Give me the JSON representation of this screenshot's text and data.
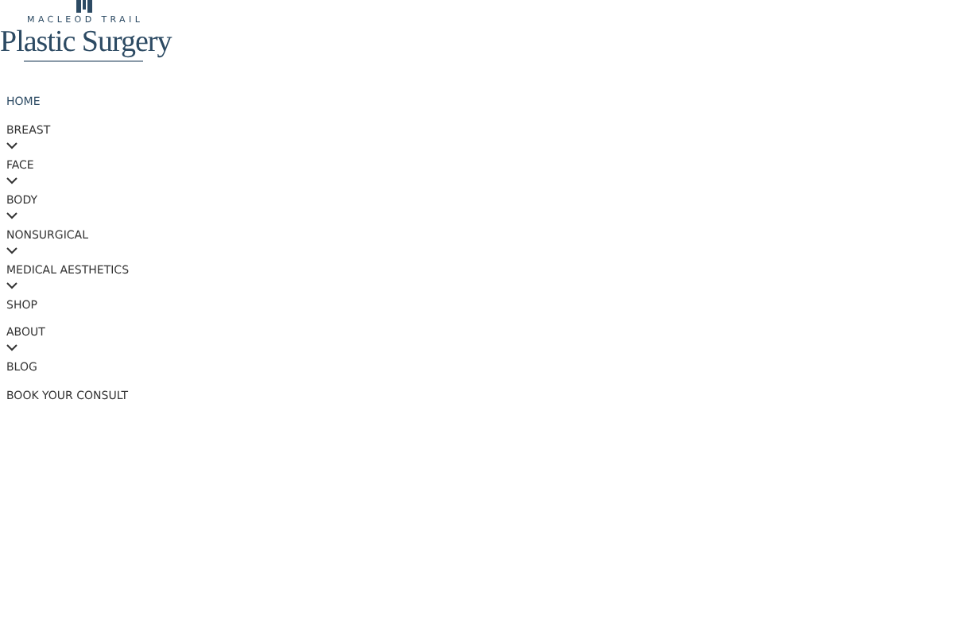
{
  "logo": {
    "tagline": "MACLEOD TRAIL",
    "name": "Plastic Surgery"
  },
  "nav": [
    {
      "label": "HOME",
      "selected": true,
      "submenu": false
    },
    {
      "label": "BREAST",
      "selected": false,
      "submenu": true
    },
    {
      "label": "FACE",
      "selected": false,
      "submenu": true
    },
    {
      "label": "BODY",
      "selected": false,
      "submenu": true
    },
    {
      "label": "NONSURGICAL",
      "selected": false,
      "submenu": true
    },
    {
      "label": "MEDICAL AESTHETICS",
      "selected": false,
      "submenu": true
    },
    {
      "label": "SHOP",
      "selected": false,
      "submenu": false
    },
    {
      "label": "ABOUT",
      "selected": false,
      "submenu": true
    },
    {
      "label": "BLOG",
      "selected": false,
      "submenu": false
    },
    {
      "label": "BOOK YOUR CONSULT",
      "selected": false,
      "submenu": false
    }
  ]
}
